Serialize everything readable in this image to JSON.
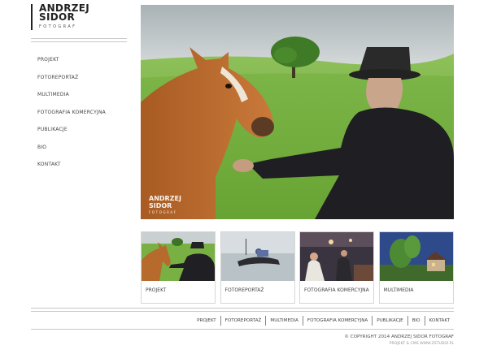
{
  "logo": {
    "name_line1": "ANDRZEJ",
    "name_line2": "SIDOR",
    "subtitle": "FOTOGRAF"
  },
  "side_nav": {
    "items": [
      {
        "label": "PROJEKT"
      },
      {
        "label": "FOTOREPORTAŻ"
      },
      {
        "label": "MULTIMEDIA"
      },
      {
        "label": "FOTOGRAFIA KOMERCYJNA"
      },
      {
        "label": "PUBLIKACJE"
      },
      {
        "label": "BIO"
      },
      {
        "label": "KONTAKT"
      }
    ]
  },
  "hero": {
    "watermark_line1": "ANDRZEJ",
    "watermark_line2": "SIDOR",
    "watermark_sub": "FOTOGRAF"
  },
  "thumbnails": [
    {
      "label": "PROJEKT"
    },
    {
      "label": "FOTOREPORTAŻ"
    },
    {
      "label": "FOTOGRAFIA KOMERCYJNA"
    },
    {
      "label": "MULTIMEDIA"
    }
  ],
  "footer_nav": {
    "items": [
      {
        "label": "PROJEKT"
      },
      {
        "label": "FOTOREPORTAŻ"
      },
      {
        "label": "MULTIMEDIA"
      },
      {
        "label": "FOTOGRAFIA KOMERCYJNA"
      },
      {
        "label": "PUBLIKACJE"
      },
      {
        "label": "BIO"
      },
      {
        "label": "KONTAKT"
      }
    ]
  },
  "footer": {
    "copyright": "© COPYRIGHT 2014 ANDRZEJ SIDOR FOTOGRAF",
    "credit": "PROJEKT & CMS WWW.ZSTUDIO.PL"
  },
  "colors": {
    "text": "#333333",
    "rule": "#c8c8c8",
    "background": "#ffffff"
  }
}
